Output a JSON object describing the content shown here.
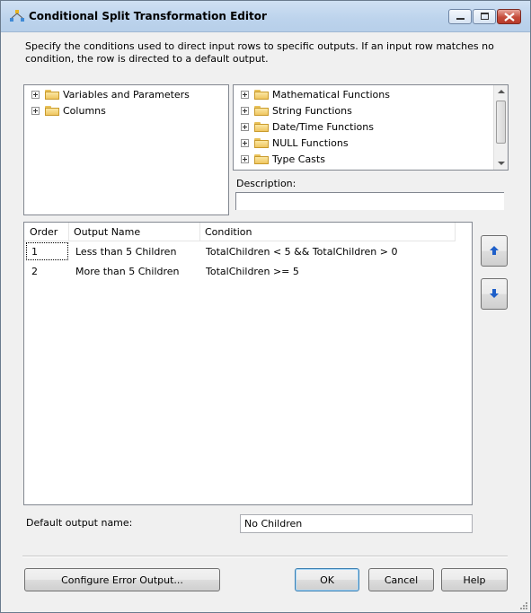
{
  "window": {
    "title": "Conditional Split Transformation Editor"
  },
  "instructions": "Specify the conditions used to direct input rows to specific outputs. If an input row matches no condition, the row is directed to a default output.",
  "left_tree": {
    "items": [
      {
        "label": "Variables and Parameters",
        "icon": "folder-icon"
      },
      {
        "label": "Columns",
        "icon": "folder-icon"
      }
    ]
  },
  "right_tree": {
    "items": [
      {
        "label": "Mathematical Functions",
        "icon": "folder-icon"
      },
      {
        "label": "String Functions",
        "icon": "folder-icon"
      },
      {
        "label": "Date/Time Functions",
        "icon": "folder-icon"
      },
      {
        "label": "NULL Functions",
        "icon": "folder-icon"
      },
      {
        "label": "Type Casts",
        "icon": "folder-icon"
      }
    ]
  },
  "description": {
    "label": "Description:",
    "value": ""
  },
  "grid": {
    "columns": [
      "Order",
      "Output Name",
      "Condition"
    ],
    "rows": [
      {
        "order": "1",
        "output_name": "Less than 5 Children",
        "condition": "TotalChildren < 5 && TotalChildren > 0"
      },
      {
        "order": "2",
        "output_name": "More than 5 Children",
        "condition": "TotalChildren >= 5"
      }
    ]
  },
  "side_buttons": {
    "up_icon": "arrow-up-icon",
    "down_icon": "arrow-down-icon"
  },
  "default_output": {
    "label": "Default output name:",
    "value": "No Children"
  },
  "buttons": {
    "configure_error": "Configure Error Output...",
    "ok": "OK",
    "cancel": "Cancel",
    "help": "Help"
  },
  "colors": {
    "accent": "#1e5fc9",
    "titlebar": "#c4d8ef",
    "close": "#c54b3a"
  }
}
